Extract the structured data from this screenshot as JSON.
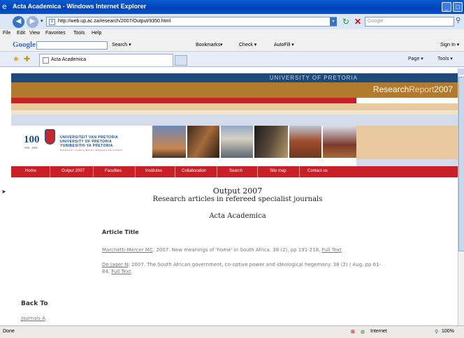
{
  "window": {
    "title": "Acta Academica - Windows Internet Explorer",
    "address": "http://web.up.ac.za/research/2007/Output/9350.html",
    "search_placeholder": "Google"
  },
  "menu": [
    "File",
    "Edit",
    "View",
    "Favorites",
    "Tools",
    "Help"
  ],
  "google_toolbar": {
    "logo": "Google",
    "items": [
      "Search ▾",
      "Bookmarks▾",
      "Check ▾",
      "AutoFill ▾",
      "Sign In ▾"
    ]
  },
  "tab": {
    "label": "Acta Academica",
    "tools": [
      "Page ▾",
      "Tools ▾"
    ]
  },
  "site": {
    "university_band": "UNIVERSITY OF PRETORIA",
    "report_title_a": "Research",
    "report_title_b": "Report",
    "report_year": "2007",
    "logo_number": "100",
    "logo_years": "1908 · 2008",
    "university_name_lines": [
      "UNIVERSITEIT VAN PRETORIA",
      "UNIVERSITY OF PRETORIA",
      "YUNIBESITHI YA PRETORIA"
    ],
    "motto": "Denkleiers • Leading Minds • Dikgopolo tsa Dihlalefi",
    "nav": [
      "Home",
      "Output 2007",
      "Faculties",
      "Institutes",
      "Collaboration",
      "Search",
      "Site map",
      "Contact us"
    ]
  },
  "content": {
    "heading": "Output 2007",
    "subheading": "Research articles in refereed specialist journals",
    "journal": "Acta Academica",
    "article_header": "Article Title",
    "entries": [
      {
        "author": "Marchetti-Mercer MC",
        "text": ": 2007. New meanings of 'home' in South Africa. 38 (2), pp 191-218, ",
        "link": "Full Text"
      },
      {
        "author": "De Jager N",
        "text": ": 2007. The South African government, co-optive power and ideological hegemony. 38 (2) / Aug, pp 61-84, ",
        "link": "Full Text"
      }
    ],
    "back_to": "Back To",
    "journals_link": "Journals A"
  },
  "status": {
    "left": "Done",
    "zone": "Internet",
    "zoom": "100%"
  }
}
